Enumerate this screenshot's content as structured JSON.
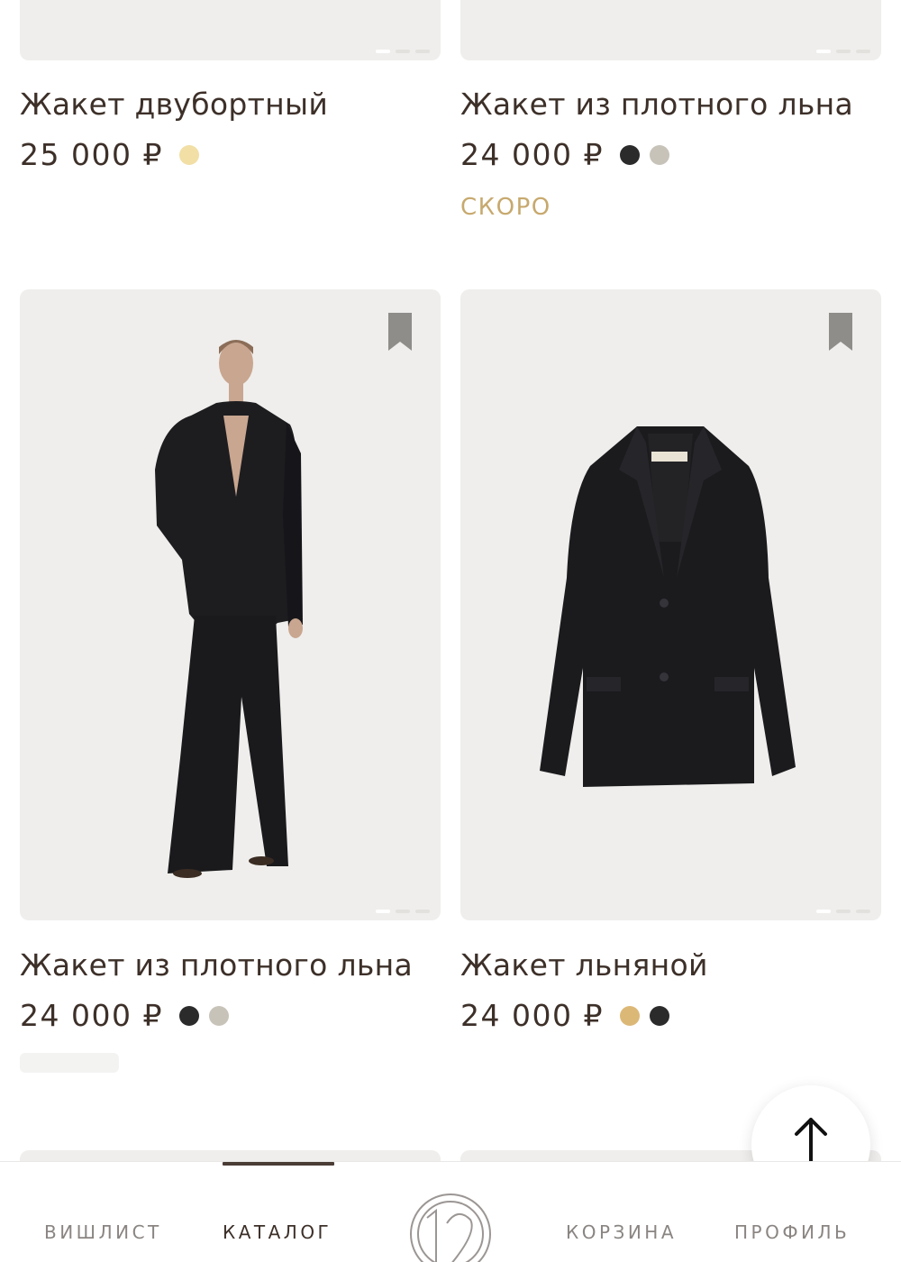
{
  "products": [
    {
      "title": "Жакет двубортный",
      "price": "25 000 ₽",
      "colors": [
        "#f2dfa6"
      ],
      "status": ""
    },
    {
      "title": "Жакет из плотного льна",
      "price": "24 000 ₽",
      "colors": [
        "#2b2b2b",
        "#c8c3b9"
      ],
      "status": "СКОРО"
    },
    {
      "title": "Жакет из плотного льна",
      "price": "24 000 ₽",
      "colors": [
        "#2b2b2b",
        "#c8c3b9"
      ],
      "status": ""
    },
    {
      "title": "Жакет льняной",
      "price": "24 000 ₽",
      "colors": [
        "#dcb877",
        "#2b2b2b"
      ],
      "status": ""
    }
  ],
  "nav": {
    "wishlist": "ВИШЛИСТ",
    "catalog": "КАТАЛОГ",
    "cart": "КОРЗИНА",
    "profile": "ПРОФИЛЬ",
    "active": "catalog"
  },
  "colors": {
    "text": "#3d3029",
    "accent_soon": "#c7a96e",
    "card_bg": "#efeeec"
  },
  "icons": {
    "bookmark": "bookmark-icon",
    "scroll_top": "arrow-up-icon",
    "logo": "brand-12-logo"
  }
}
